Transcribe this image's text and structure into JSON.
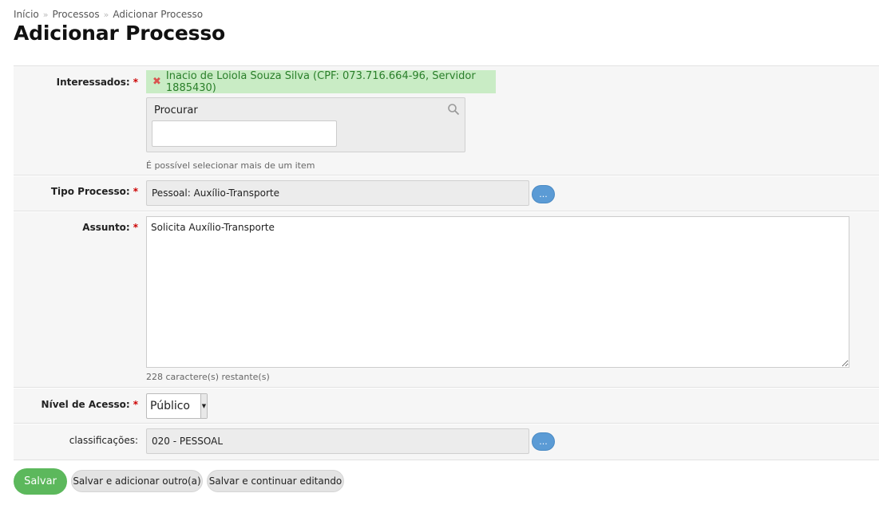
{
  "breadcrumb": [
    "Início",
    "Processos",
    "Adicionar Processo"
  ],
  "breadcrumb_separator": "»",
  "page_title": "Adicionar Processo",
  "required_marker": "*",
  "interessados": {
    "label": "Interessados:",
    "selected_item": "Inacio de Loiola Souza Silva (CPF: 073.716.664-96, Servidor 1885430)",
    "remove_icon": "✖",
    "search_label": "Procurar",
    "search_value": "",
    "help_text": "É possível selecionar mais de um item"
  },
  "tipo_processo": {
    "label": "Tipo Processo:",
    "value": "Pessoal: Auxílio-Transporte",
    "lookup_button": "..."
  },
  "assunto": {
    "label": "Assunto:",
    "value": "Solicita Auxílio-Transporte",
    "help_text": "228 caractere(s) restante(s)"
  },
  "nivel_acesso": {
    "label": "Nível de Acesso:",
    "selected": "Público"
  },
  "classificacoes": {
    "label": "classificações:",
    "value": "020 - PESSOAL",
    "lookup_button": "..."
  },
  "actions": {
    "save": "Salvar",
    "save_add_another": "Salvar e adicionar outro(a)",
    "save_continue": "Salvar e continuar editando"
  },
  "colors": {
    "chip_bg": "#c9ecc5",
    "chip_text": "#2a7f2a",
    "save_button": "#5cb85c",
    "lookup_button": "#5b9bd5",
    "required": "#cc0000"
  }
}
